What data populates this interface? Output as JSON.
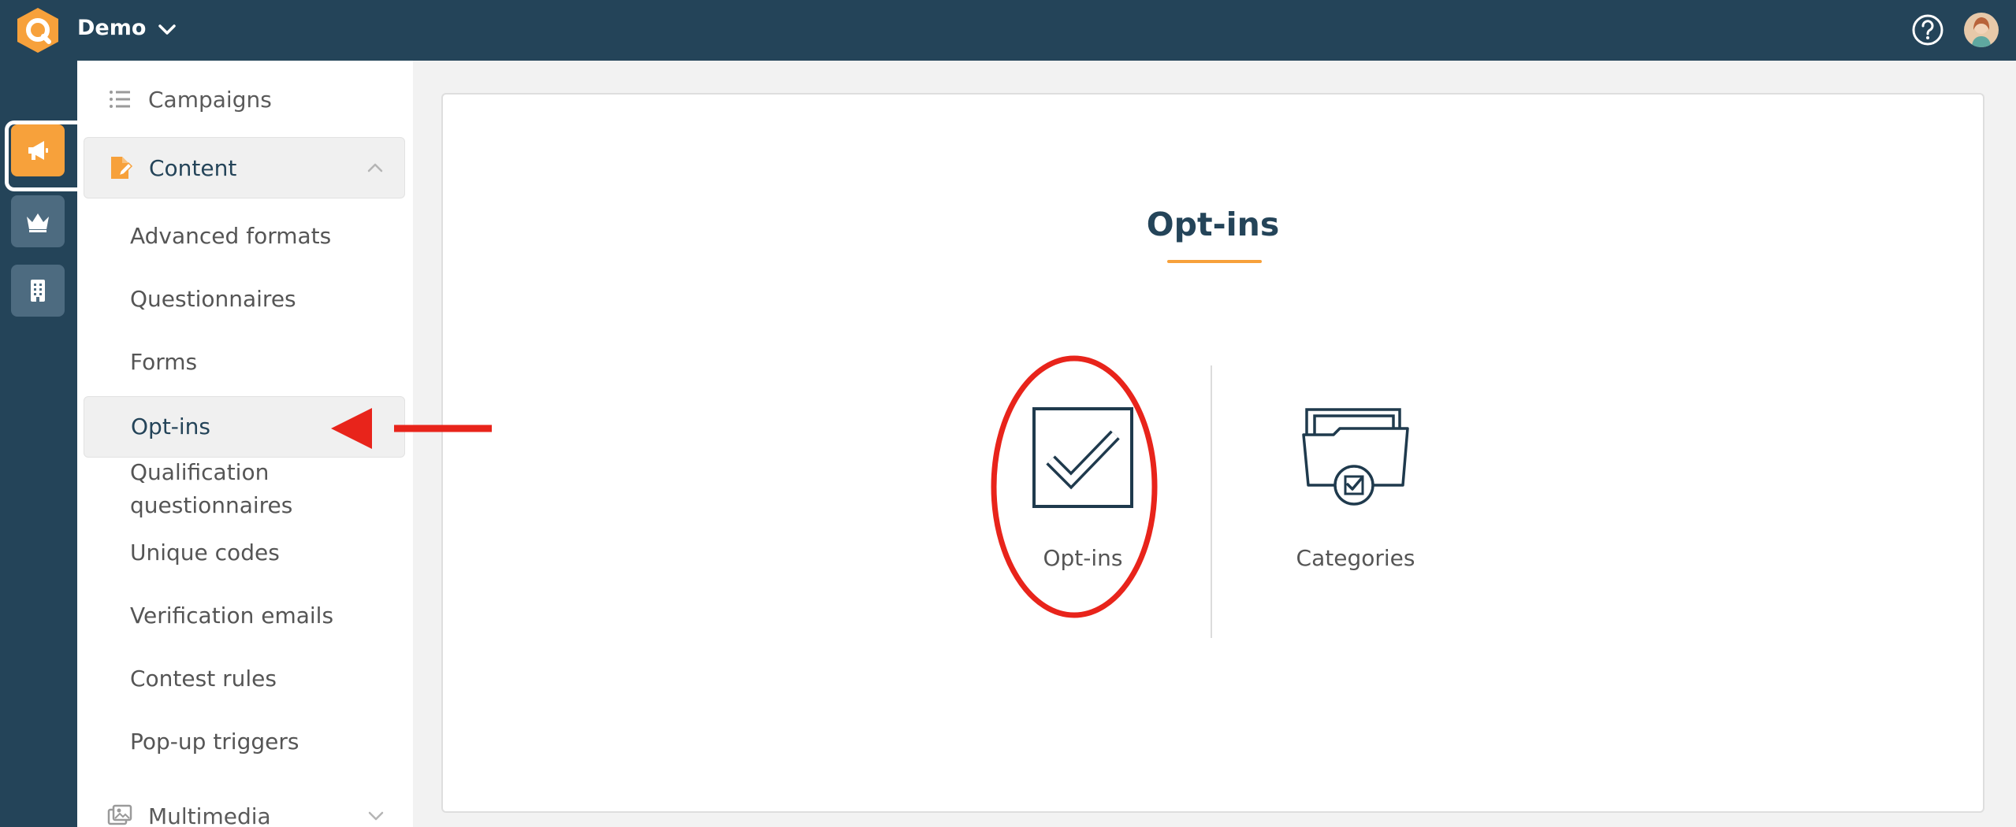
{
  "header": {
    "app_name": "Demo",
    "help_icon": "question-circle-icon",
    "avatar_icon": "user-avatar"
  },
  "rail": {
    "items": [
      {
        "icon": "megaphone-icon",
        "active": true
      },
      {
        "icon": "crown-icon",
        "active": false
      },
      {
        "icon": "building-icon",
        "active": false
      }
    ]
  },
  "sidebar": {
    "campaigns_label": "Campaigns",
    "content_label": "Content",
    "content_items": [
      "Advanced formats",
      "Questionnaires",
      "Forms",
      "Opt-ins",
      "Qualification questionnaires",
      "Unique codes",
      "Verification emails",
      "Contest rules",
      "Pop-up triggers"
    ],
    "multimedia_label": "Multimedia",
    "selected": "Opt-ins"
  },
  "main": {
    "title": "Opt-ins",
    "tiles": [
      {
        "label": "Opt-ins",
        "icon": "checkbox-icon"
      },
      {
        "label": "Categories",
        "icon": "folder-check-icon"
      }
    ]
  },
  "colors": {
    "navy": "#244459",
    "orange": "#f7a13b",
    "annotation_red": "#e8241b"
  }
}
